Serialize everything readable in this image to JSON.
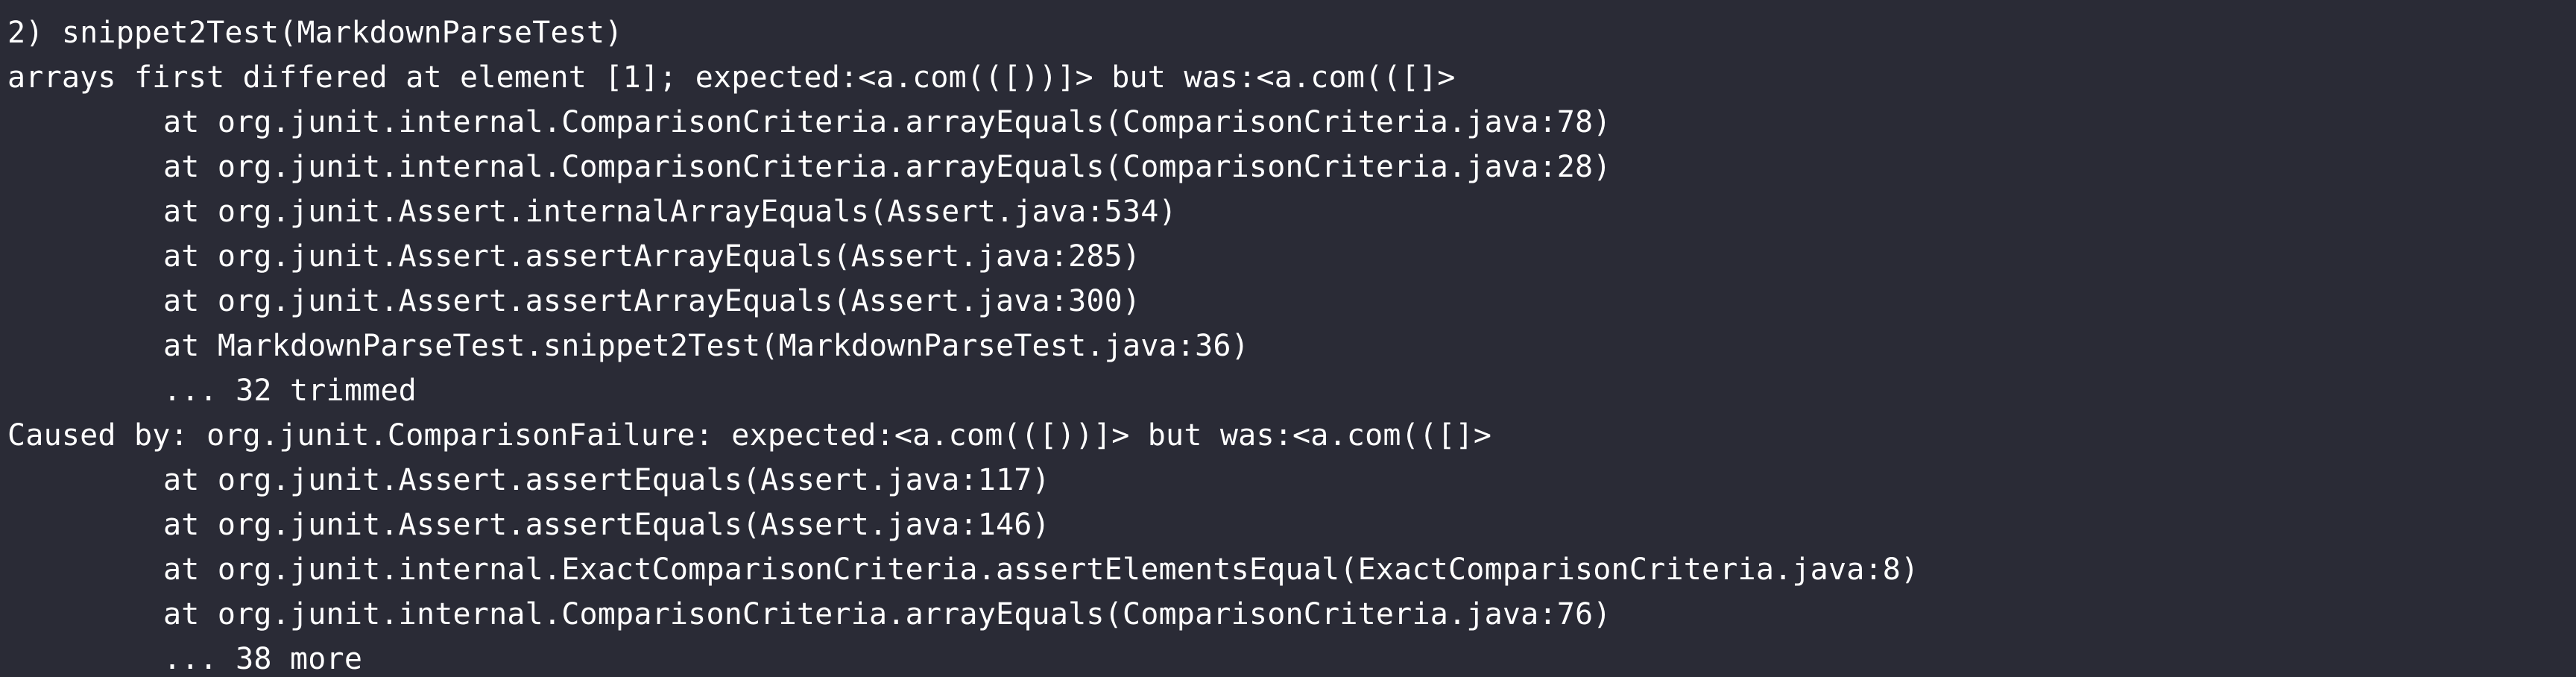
{
  "terminal": {
    "lines": [
      "2) snippet2Test(MarkdownParseTest)",
      "arrays first differed at element [1]; expected:<a.com(([))]> but was:<a.com(([]>",
      "at org.junit.internal.ComparisonCriteria.arrayEquals(ComparisonCriteria.java:78)",
      "at org.junit.internal.ComparisonCriteria.arrayEquals(ComparisonCriteria.java:28)",
      "at org.junit.Assert.internalArrayEquals(Assert.java:534)",
      "at org.junit.Assert.assertArrayEquals(Assert.java:285)",
      "at org.junit.Assert.assertArrayEquals(Assert.java:300)",
      "at MarkdownParseTest.snippet2Test(MarkdownParseTest.java:36)",
      "... 32 trimmed",
      "Caused by: org.junit.ComparisonFailure: expected:<a.com(([))]> but was:<a.com(([]>",
      "at org.junit.Assert.assertEquals(Assert.java:117)",
      "at org.junit.Assert.assertEquals(Assert.java:146)",
      "at org.junit.internal.ExactComparisonCriteria.assertElementsEqual(ExactComparisonCriteria.java:8)",
      "at org.junit.internal.ComparisonCriteria.arrayEquals(ComparisonCriteria.java:76)",
      "... 38 more"
    ]
  },
  "colors": {
    "background": "#2a2b36",
    "text": "#ffffff"
  }
}
